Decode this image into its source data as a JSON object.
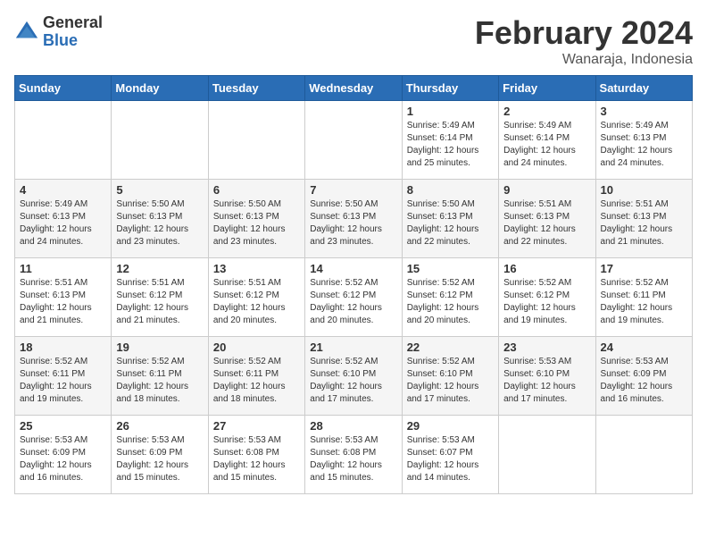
{
  "logo": {
    "general": "General",
    "blue": "Blue"
  },
  "header": {
    "month": "February 2024",
    "location": "Wanaraja, Indonesia"
  },
  "weekdays": [
    "Sunday",
    "Monday",
    "Tuesday",
    "Wednesday",
    "Thursday",
    "Friday",
    "Saturday"
  ],
  "weeks": [
    [
      {
        "day": "",
        "info": ""
      },
      {
        "day": "",
        "info": ""
      },
      {
        "day": "",
        "info": ""
      },
      {
        "day": "",
        "info": ""
      },
      {
        "day": "1",
        "info": "Sunrise: 5:49 AM\nSunset: 6:14 PM\nDaylight: 12 hours\nand 25 minutes."
      },
      {
        "day": "2",
        "info": "Sunrise: 5:49 AM\nSunset: 6:14 PM\nDaylight: 12 hours\nand 24 minutes."
      },
      {
        "day": "3",
        "info": "Sunrise: 5:49 AM\nSunset: 6:13 PM\nDaylight: 12 hours\nand 24 minutes."
      }
    ],
    [
      {
        "day": "4",
        "info": "Sunrise: 5:49 AM\nSunset: 6:13 PM\nDaylight: 12 hours\nand 24 minutes."
      },
      {
        "day": "5",
        "info": "Sunrise: 5:50 AM\nSunset: 6:13 PM\nDaylight: 12 hours\nand 23 minutes."
      },
      {
        "day": "6",
        "info": "Sunrise: 5:50 AM\nSunset: 6:13 PM\nDaylight: 12 hours\nand 23 minutes."
      },
      {
        "day": "7",
        "info": "Sunrise: 5:50 AM\nSunset: 6:13 PM\nDaylight: 12 hours\nand 23 minutes."
      },
      {
        "day": "8",
        "info": "Sunrise: 5:50 AM\nSunset: 6:13 PM\nDaylight: 12 hours\nand 22 minutes."
      },
      {
        "day": "9",
        "info": "Sunrise: 5:51 AM\nSunset: 6:13 PM\nDaylight: 12 hours\nand 22 minutes."
      },
      {
        "day": "10",
        "info": "Sunrise: 5:51 AM\nSunset: 6:13 PM\nDaylight: 12 hours\nand 21 minutes."
      }
    ],
    [
      {
        "day": "11",
        "info": "Sunrise: 5:51 AM\nSunset: 6:13 PM\nDaylight: 12 hours\nand 21 minutes."
      },
      {
        "day": "12",
        "info": "Sunrise: 5:51 AM\nSunset: 6:12 PM\nDaylight: 12 hours\nand 21 minutes."
      },
      {
        "day": "13",
        "info": "Sunrise: 5:51 AM\nSunset: 6:12 PM\nDaylight: 12 hours\nand 20 minutes."
      },
      {
        "day": "14",
        "info": "Sunrise: 5:52 AM\nSunset: 6:12 PM\nDaylight: 12 hours\nand 20 minutes."
      },
      {
        "day": "15",
        "info": "Sunrise: 5:52 AM\nSunset: 6:12 PM\nDaylight: 12 hours\nand 20 minutes."
      },
      {
        "day": "16",
        "info": "Sunrise: 5:52 AM\nSunset: 6:12 PM\nDaylight: 12 hours\nand 19 minutes."
      },
      {
        "day": "17",
        "info": "Sunrise: 5:52 AM\nSunset: 6:11 PM\nDaylight: 12 hours\nand 19 minutes."
      }
    ],
    [
      {
        "day": "18",
        "info": "Sunrise: 5:52 AM\nSunset: 6:11 PM\nDaylight: 12 hours\nand 19 minutes."
      },
      {
        "day": "19",
        "info": "Sunrise: 5:52 AM\nSunset: 6:11 PM\nDaylight: 12 hours\nand 18 minutes."
      },
      {
        "day": "20",
        "info": "Sunrise: 5:52 AM\nSunset: 6:11 PM\nDaylight: 12 hours\nand 18 minutes."
      },
      {
        "day": "21",
        "info": "Sunrise: 5:52 AM\nSunset: 6:10 PM\nDaylight: 12 hours\nand 17 minutes."
      },
      {
        "day": "22",
        "info": "Sunrise: 5:52 AM\nSunset: 6:10 PM\nDaylight: 12 hours\nand 17 minutes."
      },
      {
        "day": "23",
        "info": "Sunrise: 5:53 AM\nSunset: 6:10 PM\nDaylight: 12 hours\nand 17 minutes."
      },
      {
        "day": "24",
        "info": "Sunrise: 5:53 AM\nSunset: 6:09 PM\nDaylight: 12 hours\nand 16 minutes."
      }
    ],
    [
      {
        "day": "25",
        "info": "Sunrise: 5:53 AM\nSunset: 6:09 PM\nDaylight: 12 hours\nand 16 minutes."
      },
      {
        "day": "26",
        "info": "Sunrise: 5:53 AM\nSunset: 6:09 PM\nDaylight: 12 hours\nand 15 minutes."
      },
      {
        "day": "27",
        "info": "Sunrise: 5:53 AM\nSunset: 6:08 PM\nDaylight: 12 hours\nand 15 minutes."
      },
      {
        "day": "28",
        "info": "Sunrise: 5:53 AM\nSunset: 6:08 PM\nDaylight: 12 hours\nand 15 minutes."
      },
      {
        "day": "29",
        "info": "Sunrise: 5:53 AM\nSunset: 6:07 PM\nDaylight: 12 hours\nand 14 minutes."
      },
      {
        "day": "",
        "info": ""
      },
      {
        "day": "",
        "info": ""
      }
    ]
  ]
}
